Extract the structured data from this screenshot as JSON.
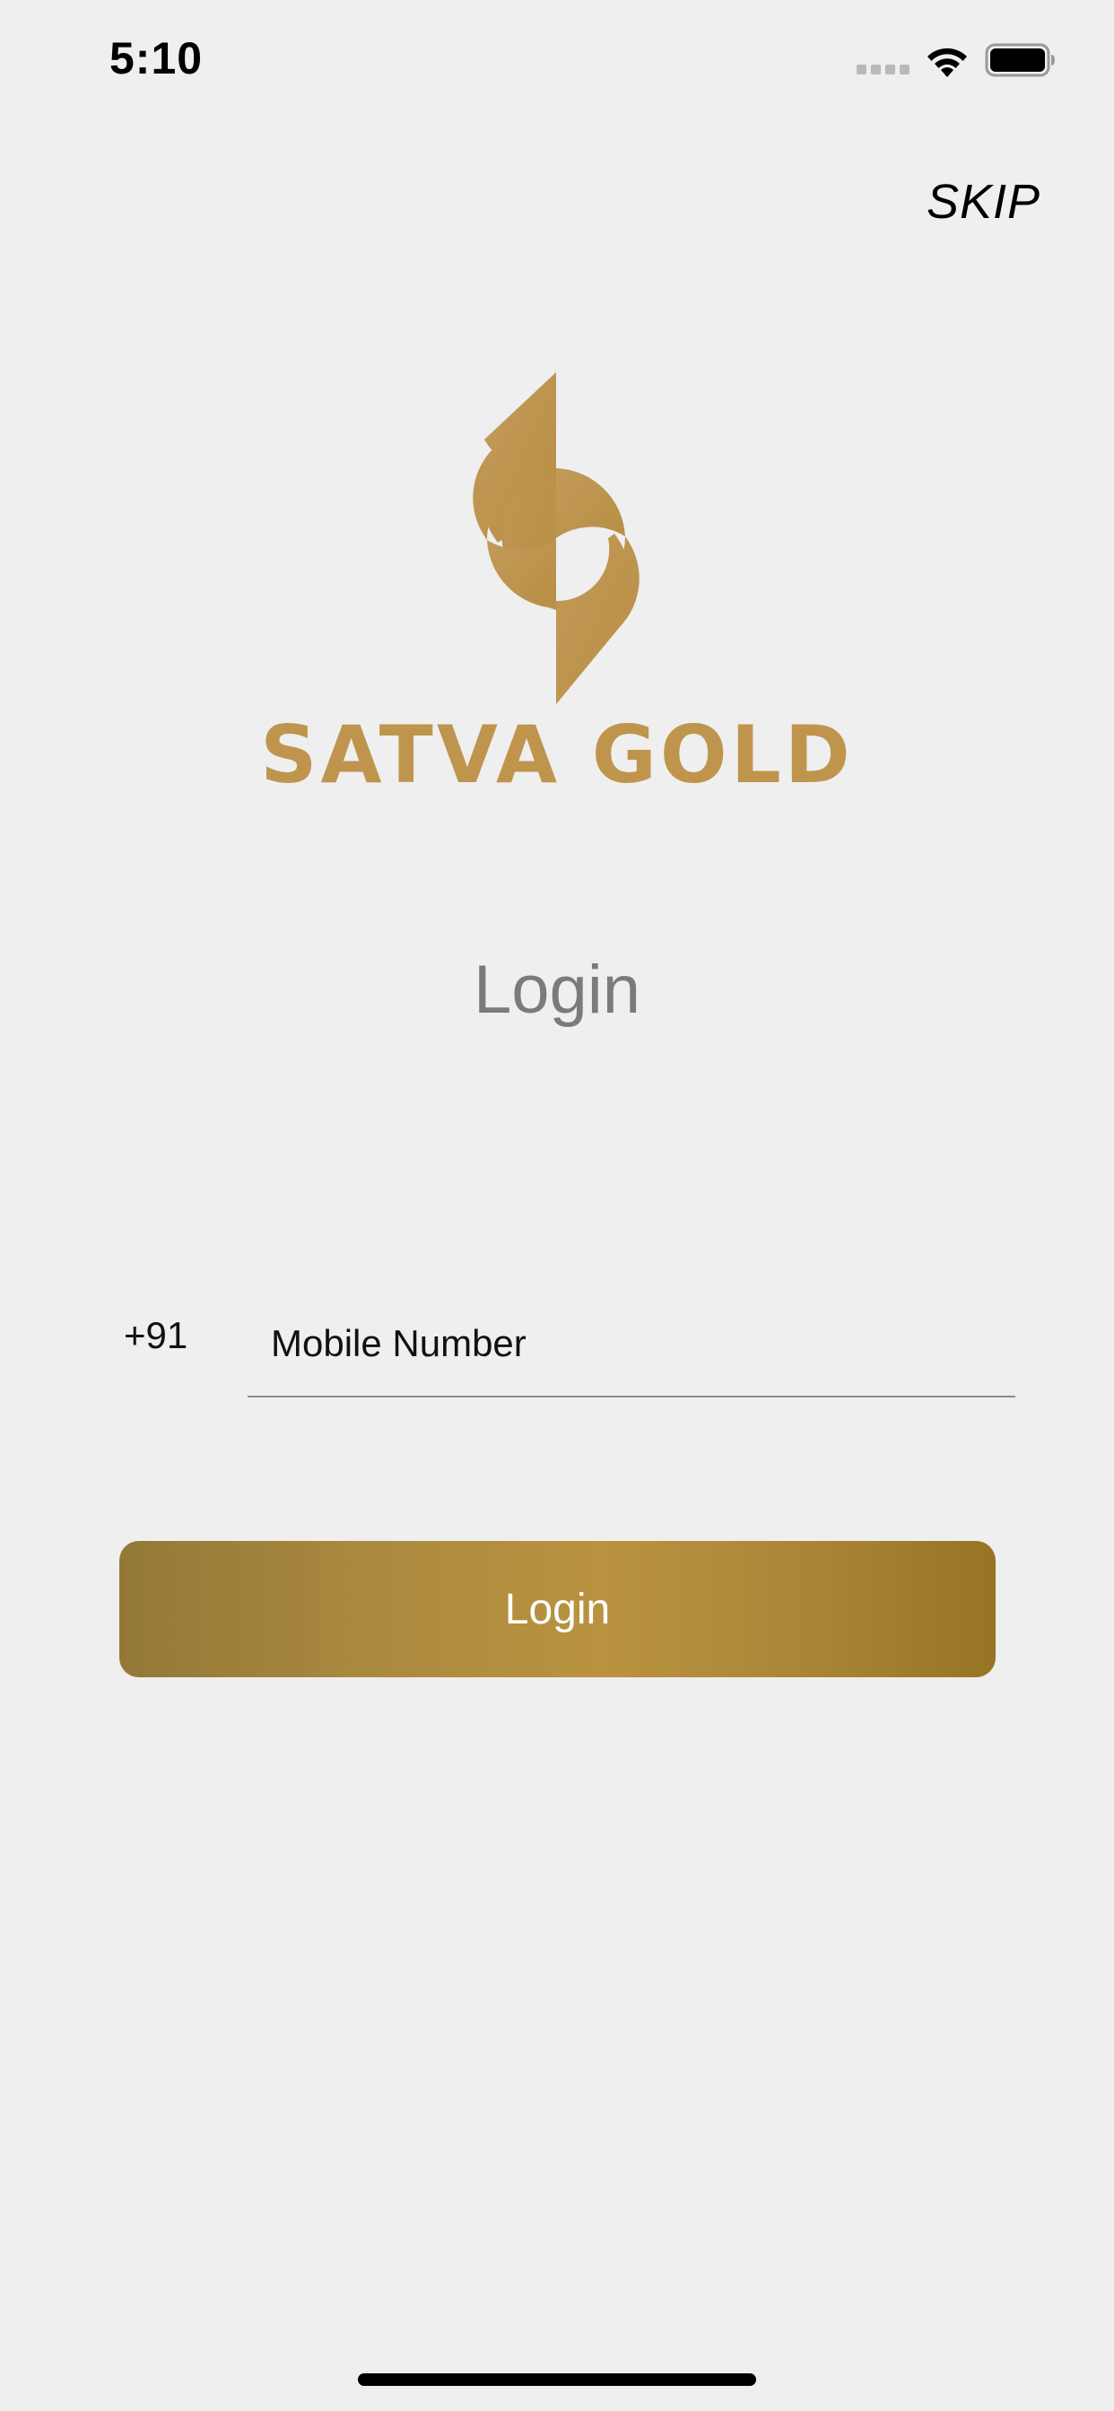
{
  "status_bar": {
    "time": "5:10",
    "icons": [
      "cellular-signal-icon",
      "wifi-icon",
      "battery-icon"
    ]
  },
  "header": {
    "skip_label": "SKIP"
  },
  "brand": {
    "name": "SATVA GOLD",
    "color": "#bf954d",
    "logo_icon": "satva-gold-logo-icon"
  },
  "login": {
    "title": "Login",
    "country_code": "+91",
    "phone_placeholder": "Mobile Number",
    "phone_value": "",
    "button_label": "Login"
  },
  "colors": {
    "background": "#efefef",
    "title": "#7b7b7b",
    "button_gradient_start": "#937835",
    "button_gradient_end": "#967424"
  }
}
